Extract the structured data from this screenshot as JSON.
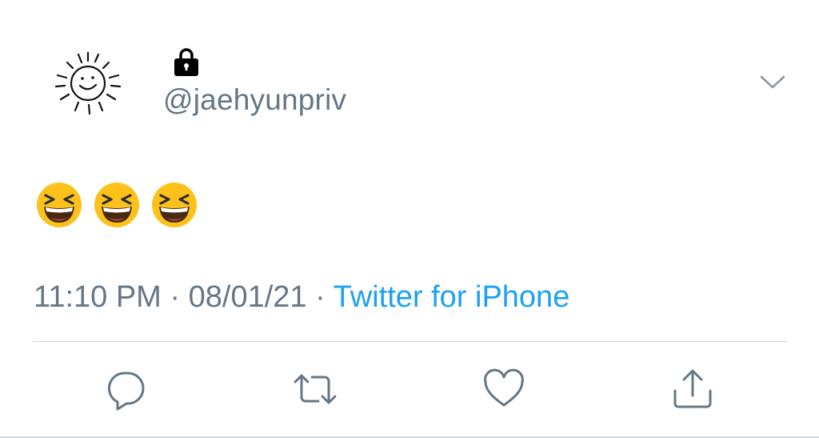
{
  "tweet": {
    "handle": "@jaehyunpriv",
    "protected": true,
    "text_emojis": [
      "laughing-face",
      "laughing-face",
      "laughing-face"
    ],
    "time": "11:10 PM",
    "separator": "·",
    "date": "08/01/21",
    "source": "Twitter for iPhone"
  },
  "actions": [
    {
      "name": "reply-icon"
    },
    {
      "name": "retweet-icon"
    },
    {
      "name": "like-icon"
    },
    {
      "name": "share-icon"
    }
  ],
  "colors": {
    "secondary_text": "#657786",
    "link": "#1da1f2",
    "divider": "#ccd6dd",
    "emoji_face": "#fcc21b"
  }
}
